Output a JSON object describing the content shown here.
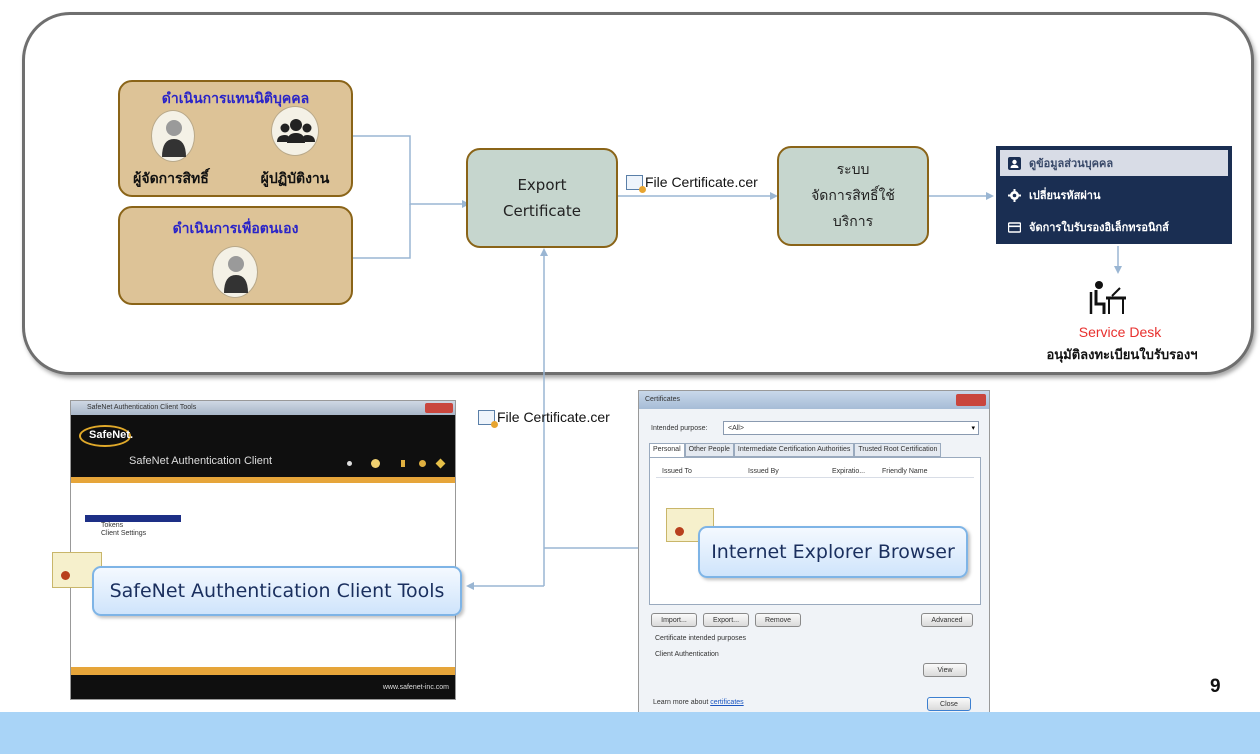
{
  "diagram": {
    "box_representative": {
      "title": "ดำเนินการแทนนิติบุคคล",
      "role_admin": "ผู้จัดการสิทธิ์",
      "role_operator": "ผู้ปฏิบัติงาน"
    },
    "box_self": {
      "title": "ดำเนินการเพื่อตนเอง"
    },
    "export_box": {
      "line1": "Export",
      "line2": "Certificate"
    },
    "file_label_top": "File Certificate.cer",
    "file_label_bottom": "File Certificate.cer",
    "system_box": {
      "line1": "ระบบ",
      "line2": "จัดการสิทธิ์ใช้",
      "line3": "บริการ"
    },
    "menu": {
      "items": [
        {
          "label": "ดูข้อมูลส่วนบุคคล",
          "icon": "user-card-icon"
        },
        {
          "label": "เปลี่ยนรหัสผ่าน",
          "icon": "gear-icon"
        },
        {
          "label": "จัดการใบรับรองอิเล็กทรอนิกส์",
          "icon": "card-icon"
        }
      ]
    },
    "service_desk": {
      "label": "Service Desk",
      "caption": "อนุมัติลงทะเบียนใบรับรองฯ"
    },
    "callout_safenet": "SafeNet Authentication Client Tools",
    "callout_ie": "Internet Explorer Browser",
    "page_number": "9"
  },
  "safenet_window": {
    "title": "SafeNet Authentication Client Tools",
    "logo": "SafeNet.",
    "header": "SafeNet Authentication Client",
    "tree": [
      "Tokens",
      "Client Settings"
    ],
    "footer_url": "www.safenet-inc.com"
  },
  "cert_dialog": {
    "title": "Certificates",
    "purpose_label": "Intended purpose:",
    "purpose_value": "<All>",
    "tabs": [
      "Personal",
      "Other People",
      "Intermediate Certification Authorities",
      "Trusted Root Certification"
    ],
    "columns": [
      "Issued To",
      "Issued By",
      "Expiratio...",
      "Friendly Name"
    ],
    "buttons": [
      "Import...",
      "Export...",
      "Remove",
      "Advanced"
    ],
    "purposes_label": "Certificate intended purposes",
    "purposes_value": "Client Authentication",
    "view_button": "View",
    "learn_more_prefix": "Learn more about ",
    "learn_more_link": "certificates",
    "close_button": "Close"
  },
  "colors": {
    "tan_fill": "#ddc397",
    "box_border": "#8a6418",
    "grey_green": "#c6d6ce",
    "menu_bg": "#1a2e52",
    "service_desk_red": "#e8302e",
    "footer_bar": "#a9d4f7",
    "title_blue": "#2a24c8"
  }
}
